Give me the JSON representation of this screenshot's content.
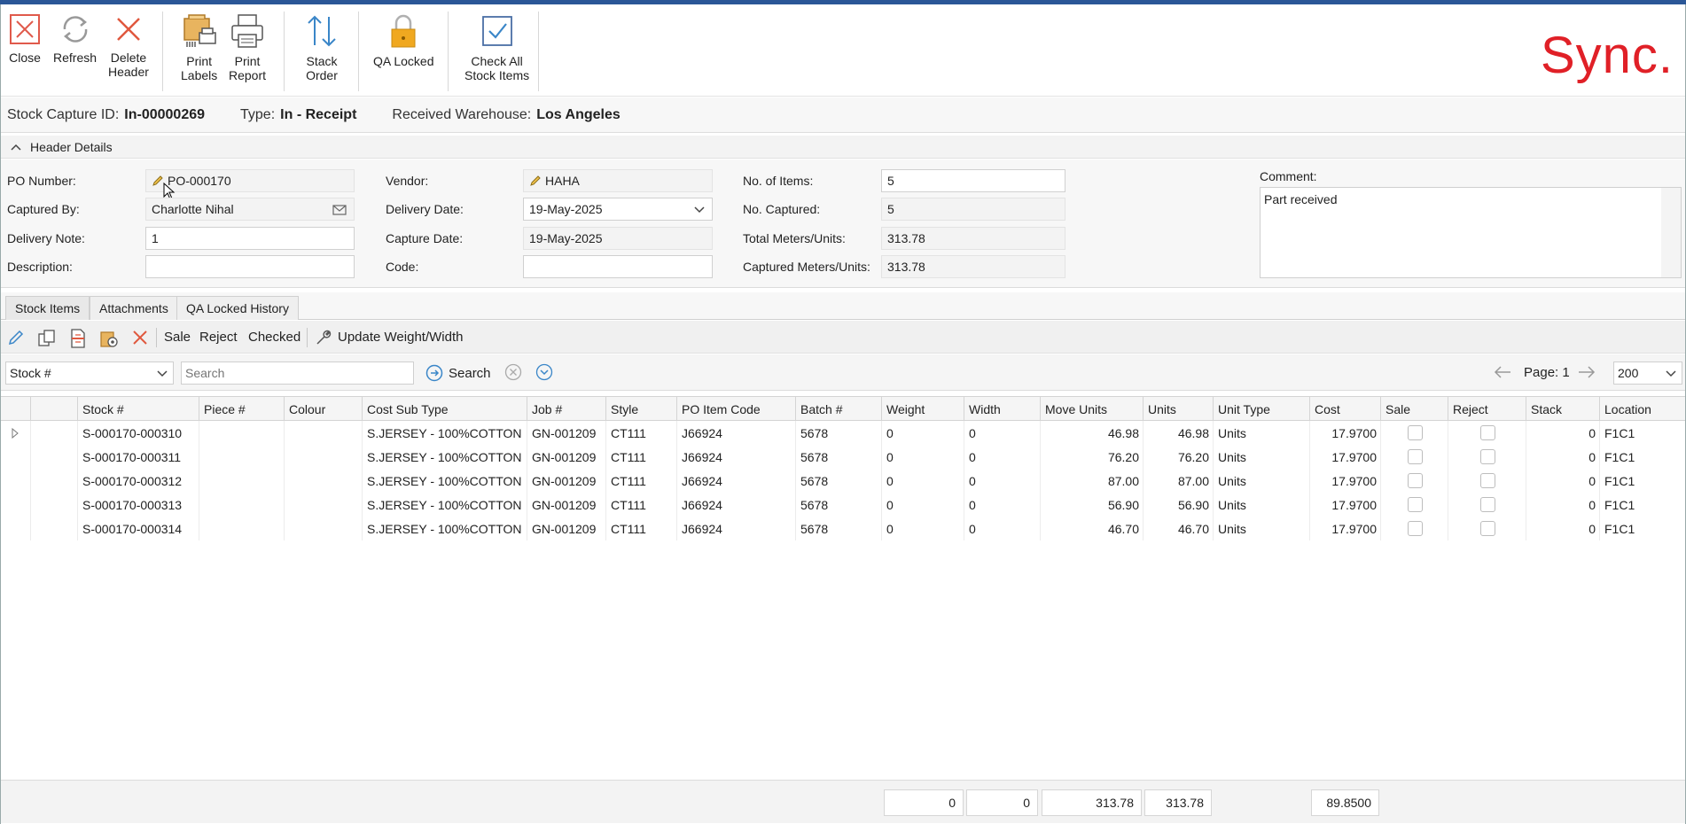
{
  "ribbon": {
    "close": "Close",
    "refresh": "Refresh",
    "delete_header": [
      "Delete",
      "Header"
    ],
    "print_labels": [
      "Print",
      "Labels"
    ],
    "print_report": [
      "Print",
      "Report"
    ],
    "stack_order": [
      "Stack",
      "Order"
    ],
    "qa_locked": "QA Locked",
    "check_all": [
      "Check All",
      "Stock Items"
    ],
    "logo": "Sync."
  },
  "info": {
    "capture_id_label": "Stock Capture ID:",
    "capture_id": "In-00000269",
    "type_label": "Type:",
    "type": "In - Receipt",
    "warehouse_label": "Received Warehouse:",
    "warehouse": "Los Angeles"
  },
  "header": {
    "title": "Header Details",
    "po_number_label": "PO Number:",
    "po_number": "PO-000170",
    "captured_by_label": "Captured By:",
    "captured_by": "Charlotte Nihal",
    "delivery_note_label": "Delivery Note:",
    "delivery_note": "1",
    "description_label": "Description:",
    "description": "",
    "vendor_label": "Vendor:",
    "vendor": "HAHA",
    "delivery_date_label": "Delivery Date:",
    "delivery_date": "19-May-2025",
    "capture_date_label": "Capture Date:",
    "capture_date": "19-May-2025",
    "code_label": "Code:",
    "code": "",
    "no_items_label": "No. of Items:",
    "no_items": "5",
    "no_captured_label": "No. Captured:",
    "no_captured": "5",
    "total_meters_label": "Total Meters/Units:",
    "total_meters": "313.78",
    "captured_meters_label": "Captured Meters/Units:",
    "captured_meters": "313.78",
    "comment_label": "Comment:",
    "comment": "Part received"
  },
  "tabs": [
    "Stock Items",
    "Attachments",
    "QA Locked History"
  ],
  "grid_toolbar": {
    "sale": "Sale",
    "reject": "Reject",
    "checked": "Checked",
    "update": "Update Weight/Width"
  },
  "search": {
    "field": "Stock #",
    "placeholder": "Search",
    "button": "Search",
    "page_label": "Page: 1",
    "page_size": "200"
  },
  "columns": [
    "Stock #",
    "Piece #",
    "Colour",
    "Cost Sub Type",
    "Job #",
    "Style",
    "PO Item Code",
    "Batch #",
    "Weight",
    "Width",
    "Move Units",
    "Units",
    "Unit Type",
    "Cost",
    "Sale",
    "Reject",
    "Stack",
    "Location"
  ],
  "rows": [
    {
      "stock": "S-000170-000310",
      "piece": "",
      "colour": "",
      "cost_sub_type": "S.JERSEY - 100%COTTON",
      "job": "GN-001209",
      "style": "CT111",
      "po_item": "J66924",
      "batch": "5678",
      "weight": "0",
      "width": "0",
      "move_units": "46.98",
      "units": "46.98",
      "unit_type": "Units",
      "cost": "17.9700",
      "stack": "0",
      "location": "F1C1"
    },
    {
      "stock": "S-000170-000311",
      "piece": "",
      "colour": "",
      "cost_sub_type": "S.JERSEY - 100%COTTON",
      "job": "GN-001209",
      "style": "CT111",
      "po_item": "J66924",
      "batch": "5678",
      "weight": "0",
      "width": "0",
      "move_units": "76.20",
      "units": "76.20",
      "unit_type": "Units",
      "cost": "17.9700",
      "stack": "0",
      "location": "F1C1"
    },
    {
      "stock": "S-000170-000312",
      "piece": "",
      "colour": "",
      "cost_sub_type": "S.JERSEY - 100%COTTON",
      "job": "GN-001209",
      "style": "CT111",
      "po_item": "J66924",
      "batch": "5678",
      "weight": "0",
      "width": "0",
      "move_units": "87.00",
      "units": "87.00",
      "unit_type": "Units",
      "cost": "17.9700",
      "stack": "0",
      "location": "F1C1"
    },
    {
      "stock": "S-000170-000313",
      "piece": "",
      "colour": "",
      "cost_sub_type": "S.JERSEY - 100%COTTON",
      "job": "GN-001209",
      "style": "CT111",
      "po_item": "J66924",
      "batch": "5678",
      "weight": "0",
      "width": "0",
      "move_units": "56.90",
      "units": "56.90",
      "unit_type": "Units",
      "cost": "17.9700",
      "stack": "0",
      "location": "F1C1"
    },
    {
      "stock": "S-000170-000314",
      "piece": "",
      "colour": "",
      "cost_sub_type": "S.JERSEY - 100%COTTON",
      "job": "GN-001209",
      "style": "CT111",
      "po_item": "J66924",
      "batch": "5678",
      "weight": "0",
      "width": "0",
      "move_units": "46.70",
      "units": "46.70",
      "unit_type": "Units",
      "cost": "17.9700",
      "stack": "0",
      "location": "F1C1"
    }
  ],
  "totals": {
    "weight": "0",
    "width": "0",
    "move_units": "313.78",
    "units": "313.78",
    "cost": "89.8500"
  },
  "colors": {
    "accent_red": "#e02027",
    "icon_blue": "#3a86c8",
    "lock_orange": "#f0a820"
  }
}
